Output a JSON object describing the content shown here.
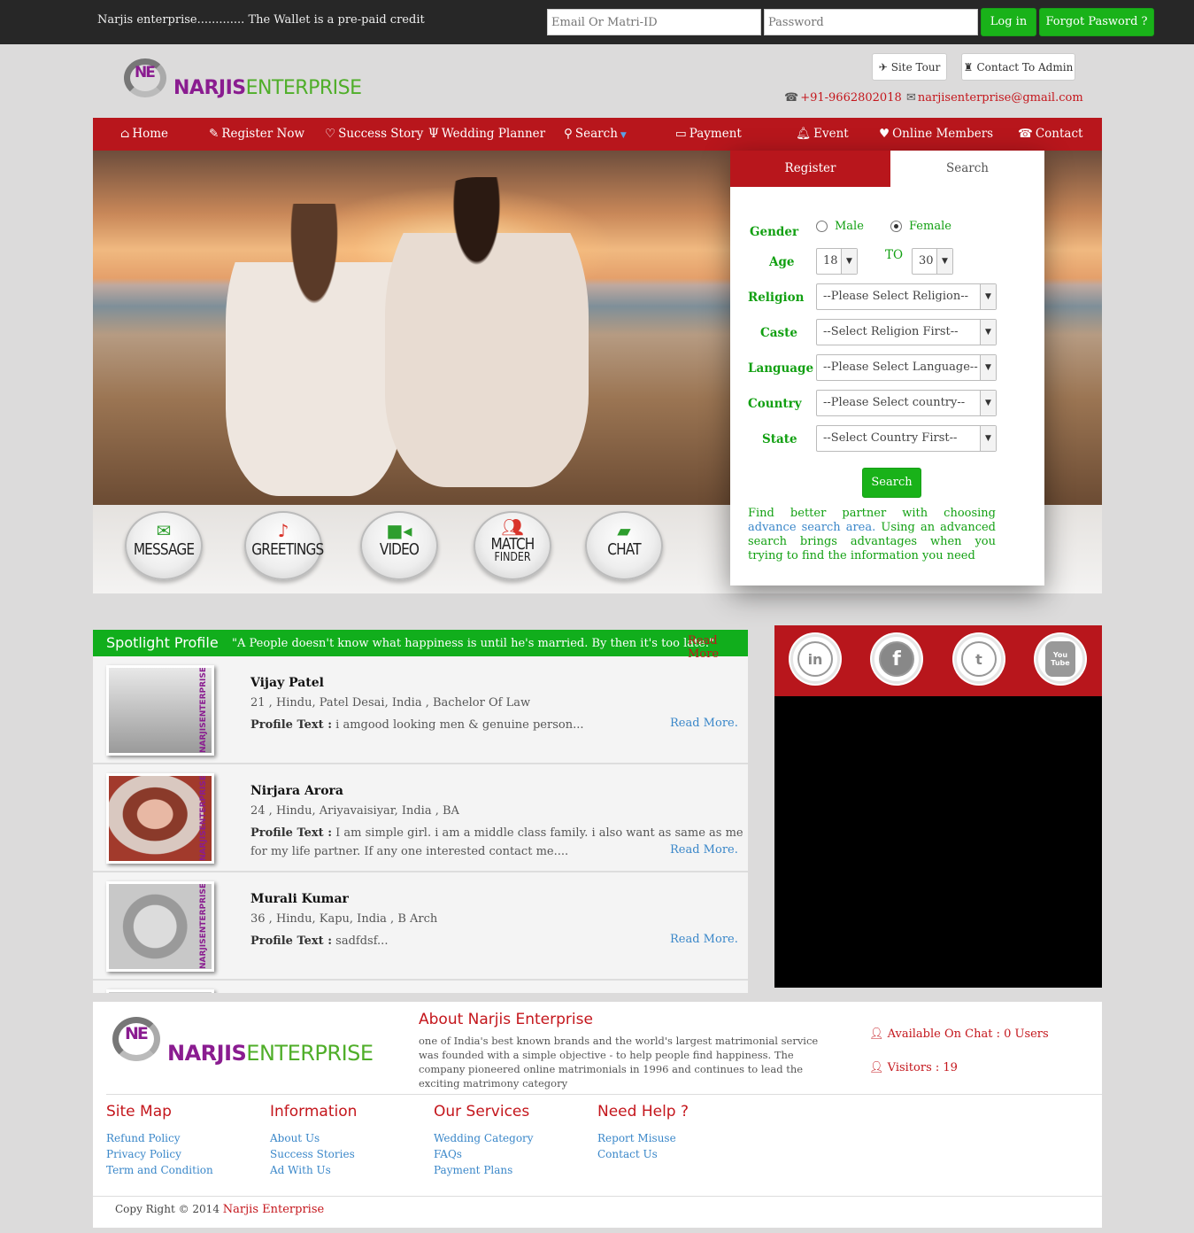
{
  "topbar": {
    "ticker": "Narjis enterprise............. The Wallet is a pre-paid credit",
    "email_placeholder": "Email Or Matri-ID",
    "password_placeholder": "Password",
    "login_label": "Log in",
    "forgot_label": "Forgot Pasword ?"
  },
  "header": {
    "logo_part1": "NARJIS",
    "logo_part2": "ENTERPRISE",
    "site_tour_label": "Site Tour",
    "contact_admin_label": "Contact To Admin",
    "phone": "+91-9662802018",
    "email": "narjisenterprise@gmail.com"
  },
  "nav": {
    "items": [
      {
        "label": "Home",
        "icon": "home-icon"
      },
      {
        "label": "Register Now",
        "icon": "pencil-icon"
      },
      {
        "label": "Success Story",
        "icon": "heart-outline-icon"
      },
      {
        "label": "Wedding Planner",
        "icon": "cutlery-icon"
      },
      {
        "label": "Search",
        "icon": "search-icon"
      },
      {
        "label": "Payment",
        "icon": "credit-card-icon"
      },
      {
        "label": "Event",
        "icon": "bell-icon"
      },
      {
        "label": "Online Members",
        "icon": "heart-icon"
      },
      {
        "label": "Contact",
        "icon": "phone-icon"
      }
    ]
  },
  "features": [
    {
      "label": "MESSAGE",
      "icon": "envelope-icon"
    },
    {
      "label": "GREETINGS",
      "icon": "music-note-icon"
    },
    {
      "label": "VIDEO",
      "icon": "video-camera-icon"
    },
    {
      "label": "MATCH",
      "label2": "FINDER",
      "icon": "users-icon"
    },
    {
      "label": "CHAT",
      "icon": "chat-bubbles-icon"
    }
  ],
  "search_panel": {
    "tab_register": "Register",
    "tab_search": "Search",
    "gender_label": "Gender",
    "male_label": "Male",
    "female_label": "Female",
    "gender_selected": "Female",
    "age_label": "Age",
    "age_from": "18",
    "to_label": "TO",
    "age_to": "30",
    "religion_label": "Religion",
    "religion_value": "--Please Select Religion--",
    "caste_label": "Caste",
    "caste_value": "--Select Religion First--",
    "language_label": "Language",
    "language_value": "--Please Select Language--",
    "country_label": "Country",
    "country_value": "--Please Select country--",
    "state_label": "State",
    "state_value": "--Select Country First--",
    "search_button": "Search",
    "help_pre": "Find better partner with choosing",
    "help_link": "advance search area.",
    "help_post": "Using an advanced search brings advantages when you trying to find the information you need"
  },
  "spotlight": {
    "title": "Spotlight Profile",
    "quote": "\"A People doesn't know what happiness is until he's married. By then it's too late.\"",
    "read_more_top": "Read More",
    "profile_text_label": "Profile Text :",
    "read_more": "Read More.",
    "profiles": [
      {
        "name": "Vijay Patel",
        "info": "21 , Hindu, Patel Desai, India , Bachelor Of Law",
        "text": "i amgood looking men & genuine person..."
      },
      {
        "name": "Nirjara Arora",
        "info": "24 , Hindu, Ariyavaisiyar, India , BA",
        "text": "I am simple girl. i am a middle class family. i also want as same as me for my life partner. If any one interested contact me...."
      },
      {
        "name": "Murali Kumar",
        "info": "36 , Hindu, Kapu, India , B Arch",
        "text": "sadfdsf..."
      }
    ],
    "watermark": "NARJISENTERPRISE"
  },
  "social": [
    {
      "name": "linkedin-icon",
      "glyph": "in"
    },
    {
      "name": "facebook-icon",
      "glyph": "f"
    },
    {
      "name": "twitter-icon",
      "glyph": "t"
    },
    {
      "name": "youtube-icon",
      "glyph": "You Tube"
    }
  ],
  "footer": {
    "about_title": "About Narjis Enterprise",
    "about_text": "one of India's best known brands and the world's largest matrimonial service was founded with a simple objective - to help people find happiness. The company pioneered online matrimonials in 1996 and continues to lead the exciting matrimony category",
    "chat_status": "Available On Chat : 0 Users",
    "visitors": "Visitors : 19",
    "columns": [
      {
        "title": "Site Map",
        "links": [
          "Refund Policy",
          "Privacy Policy",
          "Term and Condition"
        ]
      },
      {
        "title": "Information",
        "links": [
          "About Us",
          "Success Stories",
          "Ad With Us"
        ]
      },
      {
        "title": "Our Services",
        "links": [
          "Wedding Category",
          "FAQs",
          "Payment Plans"
        ]
      },
      {
        "title": "Need Help ?",
        "links": [
          "Report Misuse",
          "Contact Us"
        ]
      }
    ],
    "copyright": "Copy Right © 2014",
    "company": "Narjis Enterprise"
  },
  "colors": {
    "brand_red": "#b8161c",
    "green": "#19b219",
    "purple": "#8a1c90",
    "logo_green": "#4fae29",
    "link_blue": "#3a87c9"
  }
}
